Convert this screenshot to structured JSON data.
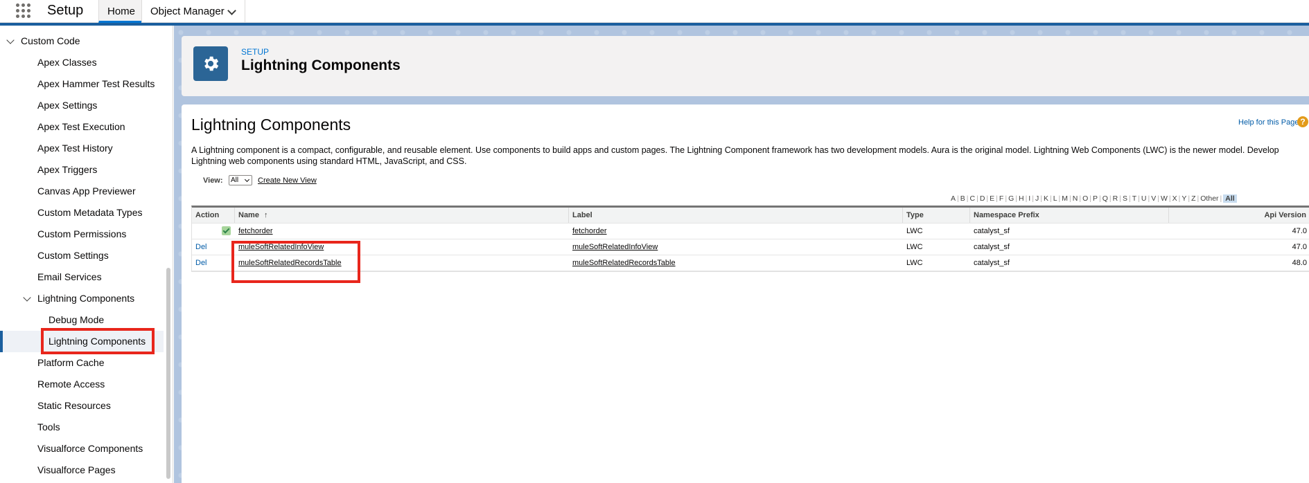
{
  "topbar": {
    "app_name": "Setup",
    "tabs": [
      {
        "label": "Home"
      },
      {
        "label": "Object Manager"
      }
    ]
  },
  "sidebar": {
    "items": [
      {
        "label": "Custom Code"
      },
      {
        "label": "Apex Classes"
      },
      {
        "label": "Apex Hammer Test Results"
      },
      {
        "label": "Apex Settings"
      },
      {
        "label": "Apex Test Execution"
      },
      {
        "label": "Apex Test History"
      },
      {
        "label": "Apex Triggers"
      },
      {
        "label": "Canvas App Previewer"
      },
      {
        "label": "Custom Metadata Types"
      },
      {
        "label": "Custom Permissions"
      },
      {
        "label": "Custom Settings"
      },
      {
        "label": "Email Services"
      },
      {
        "label": "Lightning Components"
      },
      {
        "label": "Debug Mode"
      },
      {
        "label": "Lightning Components"
      },
      {
        "label": "Platform Cache"
      },
      {
        "label": "Remote Access"
      },
      {
        "label": "Static Resources"
      },
      {
        "label": "Tools"
      },
      {
        "label": "Visualforce Components"
      },
      {
        "label": "Visualforce Pages"
      }
    ]
  },
  "header": {
    "eyebrow": "SETUP",
    "title": "Lightning Components"
  },
  "content": {
    "title": "Lightning Components",
    "help_link": "Help for this Page",
    "help_icon": "?",
    "description": "A Lightning component is a compact, configurable, and reusable element. Use components to build apps and custom pages. The Lightning Component framework has two development models. Aura is the original model. Lightning Web Components (LWC) is the newer model. Develop Lightning web components using standard HTML, JavaScript, and CSS.",
    "view_label": "View:",
    "view_selected": "All",
    "create_view": "Create New View",
    "alphabet": [
      "A",
      "B",
      "C",
      "D",
      "E",
      "F",
      "G",
      "H",
      "I",
      "J",
      "K",
      "L",
      "M",
      "N",
      "O",
      "P",
      "Q",
      "R",
      "S",
      "T",
      "U",
      "V",
      "W",
      "X",
      "Y",
      "Z",
      "Other"
    ],
    "alphabet_all": "All"
  },
  "table": {
    "headers": {
      "action": "Action",
      "name": "Name",
      "sort": "↑",
      "label": "Label",
      "type": "Type",
      "namespace": "Namespace Prefix",
      "api": "Api Version"
    },
    "rows": [
      {
        "action": "",
        "name": "fetchorder",
        "label": "fetchorder",
        "type": "LWC",
        "namespace": "catalyst_sf",
        "api": "47.0"
      },
      {
        "action": "Del",
        "name": "muleSoftRelatedInfoView",
        "label": "muleSoftRelatedInfoView",
        "type": "LWC",
        "namespace": "catalyst_sf",
        "api": "47.0"
      },
      {
        "action": "Del",
        "name": "muleSoftRelatedRecordsTable",
        "label": "muleSoftRelatedRecordsTable",
        "type": "LWC",
        "namespace": "catalyst_sf",
        "api": "48.0"
      }
    ]
  },
  "colors": {
    "brand_blue": "#1b5f9e",
    "highlight_red": "#e8261c",
    "link_blue": "#015ba7"
  }
}
